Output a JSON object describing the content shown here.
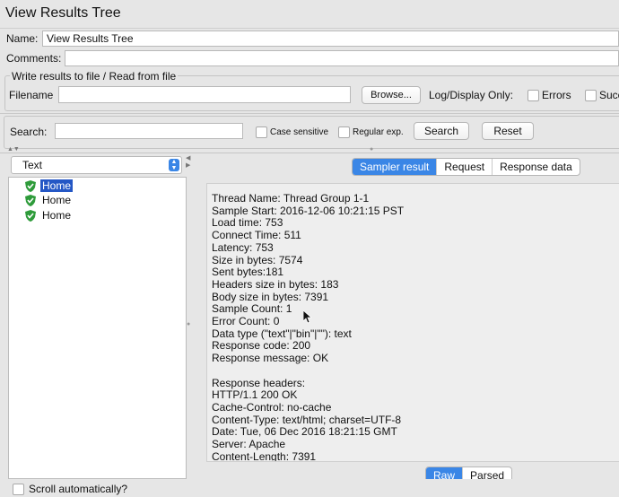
{
  "window": {
    "title": "View Results Tree"
  },
  "form": {
    "name_label": "Name:",
    "name_value": "View Results Tree",
    "comments_label": "Comments:",
    "write_legend": "Write results to file / Read from file",
    "filename_label": "Filename",
    "browse_label": "Browse...",
    "log_display_label": "Log/Display Only:",
    "errors_label": "Errors",
    "success_label": "Succ"
  },
  "search": {
    "label": "Search:",
    "case_sensitive": "Case sensitive",
    "regular_exp": "Regular exp.",
    "search_button": "Search",
    "reset_button": "Reset"
  },
  "renderer": {
    "selected": "Text"
  },
  "tree": {
    "items": [
      {
        "label": "Home",
        "selected": true
      },
      {
        "label": "Home",
        "selected": false
      },
      {
        "label": "Home",
        "selected": false
      }
    ]
  },
  "tabs": {
    "sampler_result": "Sampler result",
    "request": "Request",
    "response_data": "Response data",
    "active": "Sampler result"
  },
  "result_lines": [
    "Thread Name: Thread Group 1-1",
    "Sample Start: 2016-12-06 10:21:15 PST",
    "Load time: 753",
    "Connect Time: 511",
    "Latency: 753",
    "Size in bytes: 7574",
    "Sent bytes:181",
    "Headers size in bytes: 183",
    "Body size in bytes: 7391",
    "Sample Count: 1",
    "Error Count: 0",
    "Data type (\"text\"|\"bin\"|\"\"): text",
    "Response code: 200",
    "Response message: OK",
    "",
    "Response headers:",
    "HTTP/1.1 200 OK",
    "Cache-Control: no-cache",
    "Content-Type: text/html; charset=UTF-8",
    "Date: Tue, 06 Dec 2016 18:21:15 GMT",
    "Server: Apache",
    "Content-Length: 7391"
  ],
  "view_mode": {
    "raw": "Raw",
    "parsed": "Parsed",
    "active": "Raw"
  },
  "footer": {
    "scroll_auto": "Scroll automatically?"
  },
  "colors": {
    "accent": "#3a86e6",
    "selection": "#2457c5",
    "success_icon": "#2e9b3a"
  }
}
